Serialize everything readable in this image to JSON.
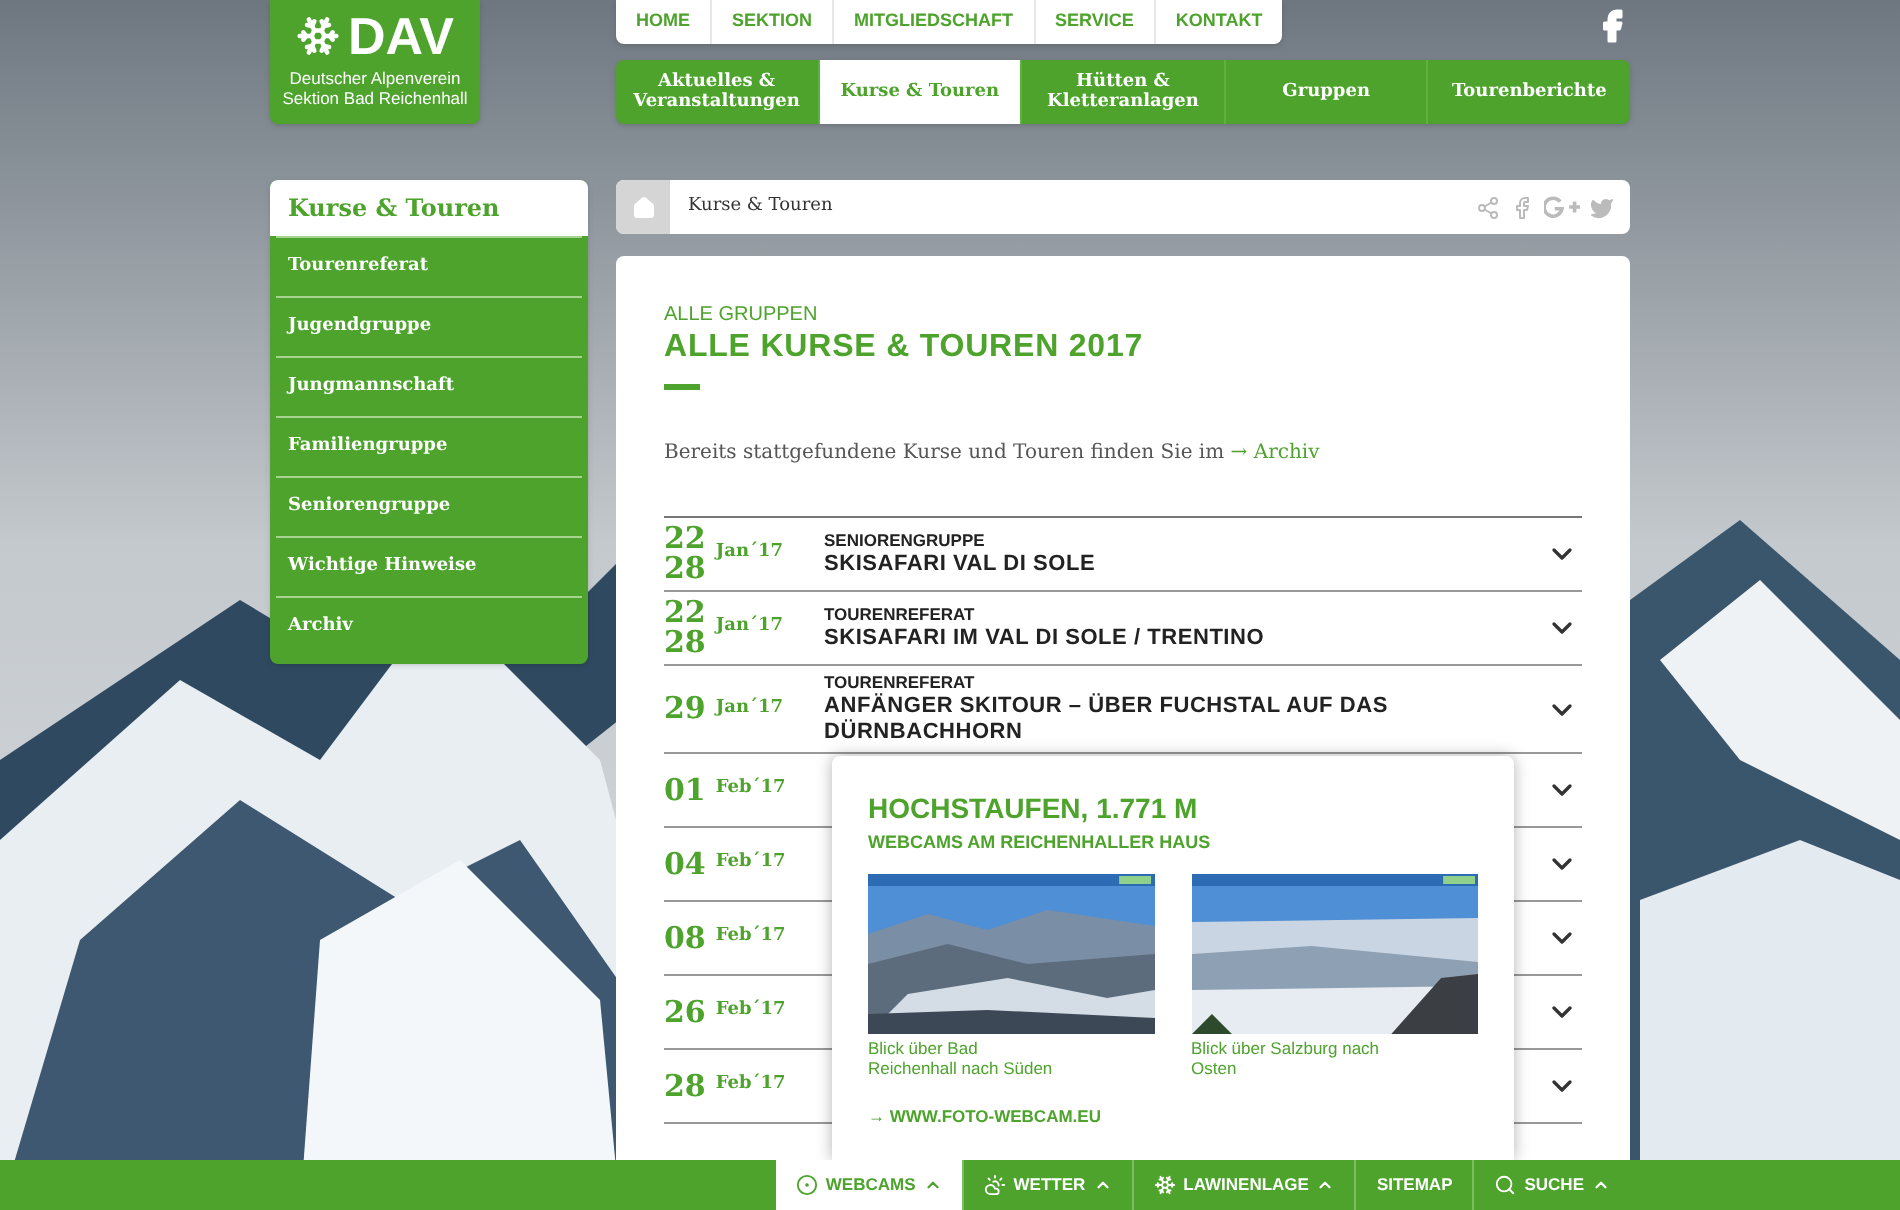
{
  "logo": {
    "mark": "DAV",
    "line_1": "Deutscher Alpenverein",
    "line_2": "Sektion Bad Reichenhall"
  },
  "top_nav": [
    "HOME",
    "SEKTION",
    "MITGLIEDSCHAFT",
    "SERVICE",
    "KONTAKT"
  ],
  "main_nav": [
    {
      "label": "Aktuelles & Veranstaltungen",
      "selected": false
    },
    {
      "label": "Kurse & Touren",
      "selected": true
    },
    {
      "label": "Hütten & Kletteranlagen",
      "selected": false
    },
    {
      "label": "Gruppen",
      "selected": false
    },
    {
      "label": "Tourenberichte",
      "selected": false
    }
  ],
  "sidebar": {
    "title": "Kurse & Touren",
    "items": [
      "Tourenreferat",
      "Jugendgruppe",
      "Jungmannschaft",
      "Familiengruppe",
      "Seniorengruppe",
      "Wichtige Hinweise",
      "Archiv"
    ]
  },
  "breadcrumb": {
    "current": "Kurse & Touren"
  },
  "content": {
    "kicker": "ALLE GRUPPEN",
    "title": "ALLE KURSE & TOUREN 2017",
    "intro": "Bereits stattgefundene Kurse und Touren finden Sie im",
    "intro_link": "→ Archiv",
    "events": [
      {
        "day_from": "22",
        "day_to": "28",
        "month": "Jan´17",
        "group": "SENIORENGRUPPE",
        "title": "SKISAFARI VAL DI SOLE"
      },
      {
        "day_from": "22",
        "day_to": "28",
        "month": "Jan´17",
        "group": "TOURENREFERAT",
        "title": "SKISAFARI IM VAL DI SOLE / TRENTINO"
      },
      {
        "day_from": "29",
        "month": "Jan´17",
        "group": "TOURENREFERAT",
        "title": "ANFÄNGER SKITOUR – ÜBER FUCHSTAL AUF DAS DÜRNBACHHORN"
      },
      {
        "day_from": "01",
        "month": "Feb´17"
      },
      {
        "day_from": "04",
        "month": "Feb´17"
      },
      {
        "day_from": "08",
        "month": "Feb´17"
      },
      {
        "day_from": "26",
        "month": "Feb´17"
      },
      {
        "day_from": "28",
        "month": "Feb´17"
      }
    ]
  },
  "webcam_popup": {
    "title": "HOCHSTAUFEN, 1.771 M",
    "subtitle": "WEBCAMS AM REICHENHALLER HAUS",
    "cams": [
      {
        "kind": "picture",
        "caption": "Blick über Bad Reichenhall nach Süden"
      },
      {
        "kind": "picture",
        "caption": "Blick über Salzburg nach Osten"
      }
    ],
    "link": "→ WWW.FOTO-WEBCAM.EU"
  },
  "bottom_bar": [
    {
      "label": "WEBCAMS",
      "selected": true,
      "dropdown": true
    },
    {
      "label": "WETTER",
      "selected": false,
      "dropdown": true
    },
    {
      "label": "LAWINENLAGE",
      "selected": false,
      "dropdown": true
    },
    {
      "label": "SITEMAP",
      "selected": false,
      "dropdown": false
    },
    {
      "label": "SUCHE",
      "selected": false,
      "dropdown": true
    }
  ]
}
